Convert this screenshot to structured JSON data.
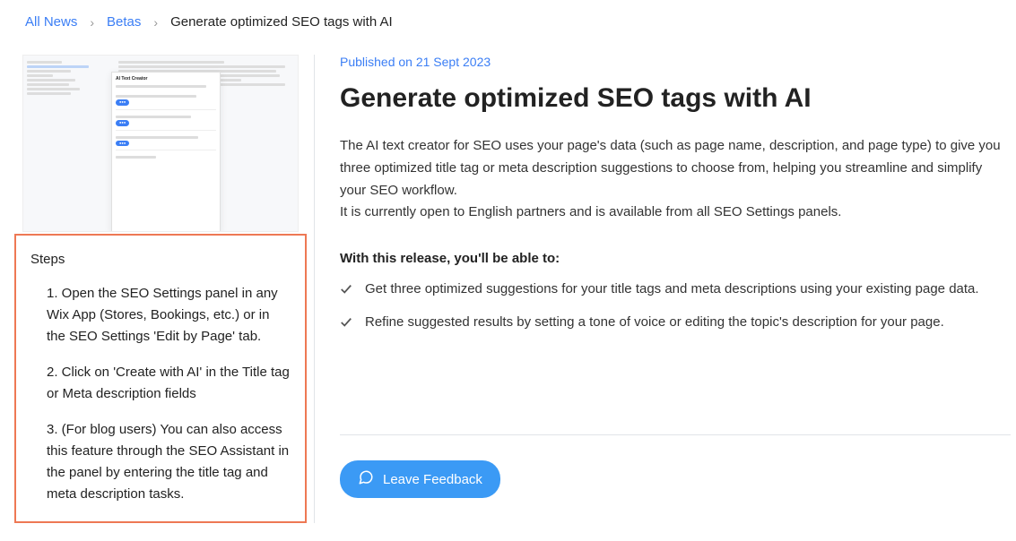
{
  "breadcrumb": {
    "items": [
      "All News",
      "Betas"
    ],
    "current": "Generate optimized SEO tags with AI"
  },
  "thumbnail": {
    "panel_title": "AI Text Creator"
  },
  "steps": {
    "title": "Steps",
    "items": [
      "1. Open the SEO Settings panel in any Wix App (Stores, Bookings, etc.) or in the SEO Settings 'Edit by Page' tab.",
      "2. Click on 'Create with AI' in the Title tag or Meta description fields",
      "3. (For blog users) You can also access this feature through the SEO Assistant in the panel by entering the title tag and meta description tasks."
    ]
  },
  "article": {
    "published": "Published on 21 Sept 2023",
    "title": "Generate optimized SEO tags with AI",
    "description_p1": "The AI text creator for SEO uses your page's data (such as page name, description, and page type)  to give you three optimized title tag or meta description suggestions to choose from, helping you streamline and simplify your SEO workflow.",
    "description_p2": "It is currently open to English partners and is available from all SEO Settings panels.",
    "subtitle": "With this release, you'll be able to:",
    "bullets": [
      "Get three optimized suggestions for your title tags and meta descriptions using your existing page data.",
      "Refine suggested results by setting a tone of voice or editing the topic's description for your page."
    ]
  },
  "feedback": {
    "label": "Leave Feedback"
  }
}
